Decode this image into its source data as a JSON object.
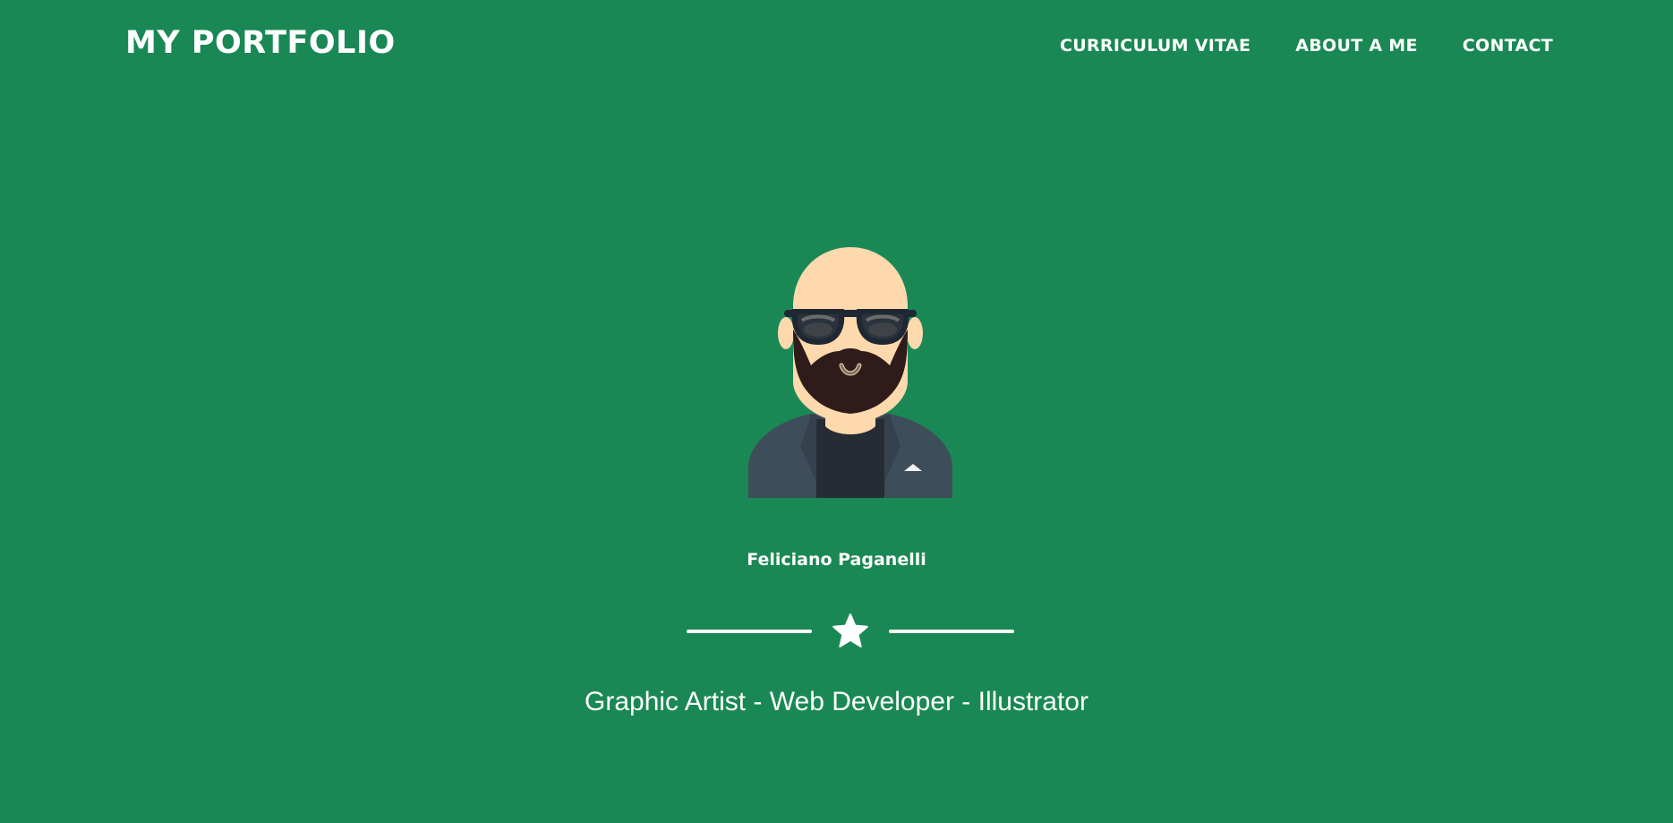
{
  "page": {
    "background_color": "#1a8854",
    "text_color": "#ffffff"
  },
  "navbar": {
    "brand": "MY PORTFOLIO",
    "links": [
      {
        "label": "CURRICULUM VITAE"
      },
      {
        "label": "ABOUT A ME"
      },
      {
        "label": "CONTACT"
      }
    ]
  },
  "hero": {
    "avatar_icon": "bald-bearded-man-with-sunglasses-avatar",
    "name": "Feliciano Paganelli",
    "divider_icon": "star-icon",
    "subtitle": "Graphic Artist - Web Developer - Illustrator"
  }
}
